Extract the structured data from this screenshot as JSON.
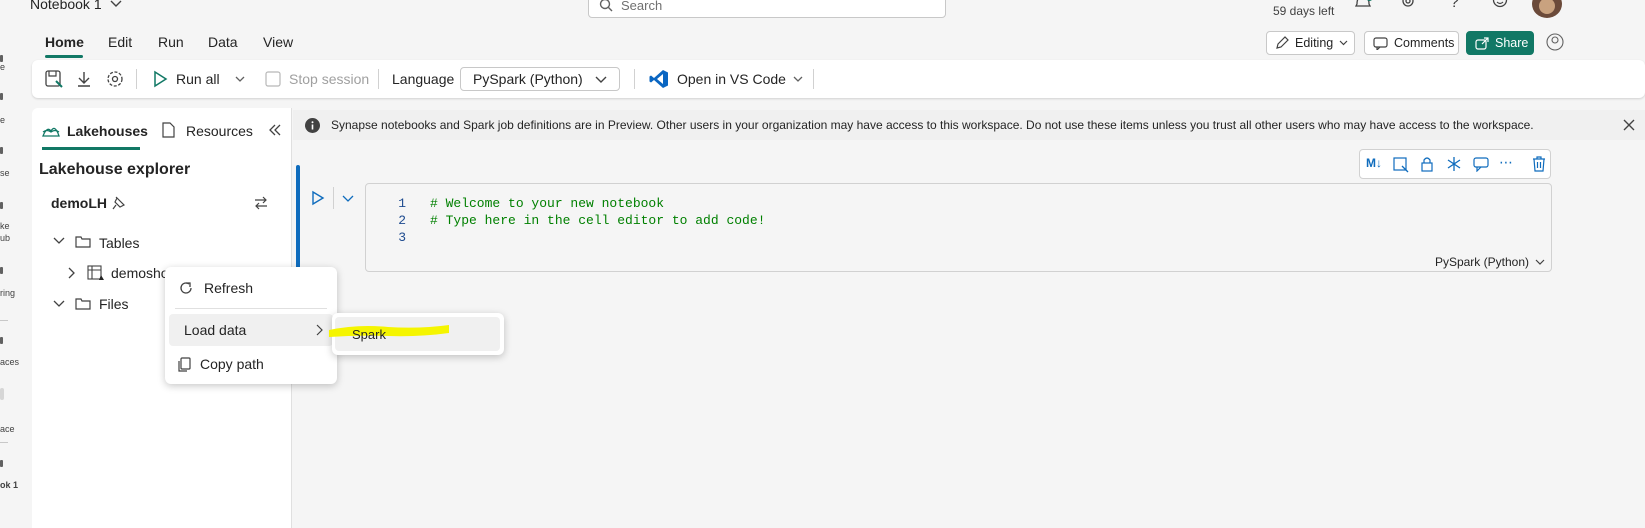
{
  "rail": {
    "labels": [
      "e",
      "e",
      "se",
      "ke",
      "ub",
      "ring",
      "aces",
      "ace",
      "ok 1"
    ]
  },
  "header": {
    "notebook_title": "Notebook 1",
    "search_placeholder": "Search",
    "trial_text": "59 days left"
  },
  "menu": {
    "tabs": [
      "Home",
      "Edit",
      "Run",
      "Data",
      "View"
    ],
    "active_tab": "Home",
    "editing_label": "Editing",
    "comments_label": "Comments",
    "share_label": "Share"
  },
  "toolbar": {
    "run_all_label": "Run all",
    "stop_session_label": "Stop session",
    "language_label": "Language",
    "language_value": "PySpark (Python)",
    "vscode_label": "Open in VS Code"
  },
  "left_panel": {
    "tab_lakehouses": "Lakehouses",
    "tab_resources": "Resources",
    "title": "Lakehouse explorer",
    "lakehouse_name": "demoLH",
    "tree": {
      "tables_label": "Tables",
      "table_item": "demosho",
      "files_label": "Files"
    }
  },
  "info_bar": {
    "message": "Synapse notebooks and Spark job definitions are in Preview. Other users in your organization may have access to this workspace. Do not use these items unless you trust all other users who may have access to the workspace."
  },
  "cell": {
    "lines": [
      {
        "n": "1",
        "code": "# Welcome to your new notebook"
      },
      {
        "n": "2",
        "code": "# Type here in the cell editor to add code!"
      },
      {
        "n": "3",
        "code": ""
      }
    ],
    "language": "PySpark (Python)",
    "toolbar_ml": "M↓"
  },
  "context_menu": {
    "refresh": "Refresh",
    "load_data": "Load data",
    "copy_path": "Copy path",
    "submenu_spark": "Spark"
  },
  "colors": {
    "accent": "#117865",
    "highlight": "#ffff00",
    "code_comment": "#008000",
    "line_number": "#1e4b8f"
  }
}
